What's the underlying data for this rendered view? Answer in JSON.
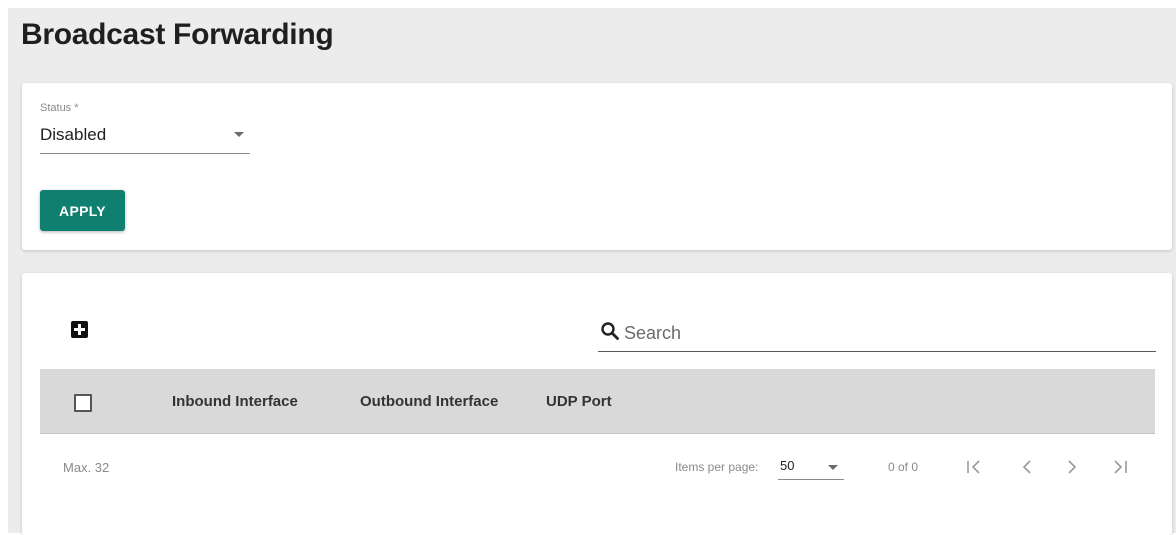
{
  "page": {
    "title": "Broadcast Forwarding"
  },
  "status_section": {
    "status_label": "Status *",
    "status_value": "Disabled",
    "apply_label": "APPLY"
  },
  "table_section": {
    "add_icon": "plus-box-icon",
    "search": {
      "icon": "search-icon",
      "placeholder": "Search",
      "value": ""
    },
    "columns": [
      "Inbound Interface",
      "Outbound Interface",
      "UDP Port"
    ],
    "rows": [],
    "footer": {
      "max_label": "Max. 32",
      "items_per_page_label": "Items per page:",
      "items_per_page_value": "50",
      "range_label": "0 of 0"
    },
    "pager_icons": [
      "first-page-icon",
      "previous-page-icon",
      "next-page-icon",
      "last-page-icon"
    ]
  },
  "colors": {
    "accent": "#0f8070",
    "page_background": "#ececec",
    "table_header_background": "#d9d9d9"
  }
}
